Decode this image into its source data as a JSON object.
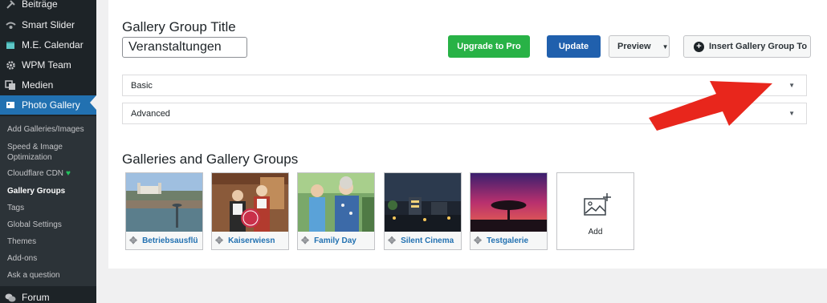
{
  "sidebar": {
    "items": [
      {
        "label": "Beiträge",
        "icon": "pin-icon"
      },
      {
        "label": "Smart Slider",
        "icon": "slider-icon"
      },
      {
        "label": "M.E. Calendar",
        "icon": "calendar-icon"
      },
      {
        "label": "WPM Team",
        "icon": "gear-icon"
      },
      {
        "label": "Medien",
        "icon": "media-icon"
      },
      {
        "label": "Photo Gallery",
        "icon": "gallery-icon"
      },
      {
        "label": "Forum",
        "icon": "forum-icon"
      }
    ],
    "submenu": [
      "Add Galleries/Images",
      "Speed & Image Optimization",
      "Cloudflare CDN",
      "Gallery Groups",
      "Tags",
      "Global Settings",
      "Themes",
      "Add-ons",
      "Ask a question"
    ]
  },
  "main": {
    "group_title_label": "Gallery Group Title",
    "group_title_value": "Veranstaltungen",
    "buttons": {
      "upgrade": "Upgrade to Pro",
      "update": "Update",
      "preview": "Preview",
      "insert": "Insert Gallery Group To"
    },
    "accordions": [
      "Basic",
      "Advanced"
    ],
    "galleries_label": "Galleries and Gallery Groups",
    "galleries": [
      {
        "name": "Betriebsausflü"
      },
      {
        "name": "Kaiserwiesn"
      },
      {
        "name": "Family Day"
      },
      {
        "name": "Silent Cinema"
      },
      {
        "name": "Testgalerie"
      }
    ],
    "add_label": "Add"
  },
  "colors": {
    "accent_blue": "#2271b1",
    "upgrade_green": "#28b246",
    "annotation_arrow": "#e8261c"
  }
}
